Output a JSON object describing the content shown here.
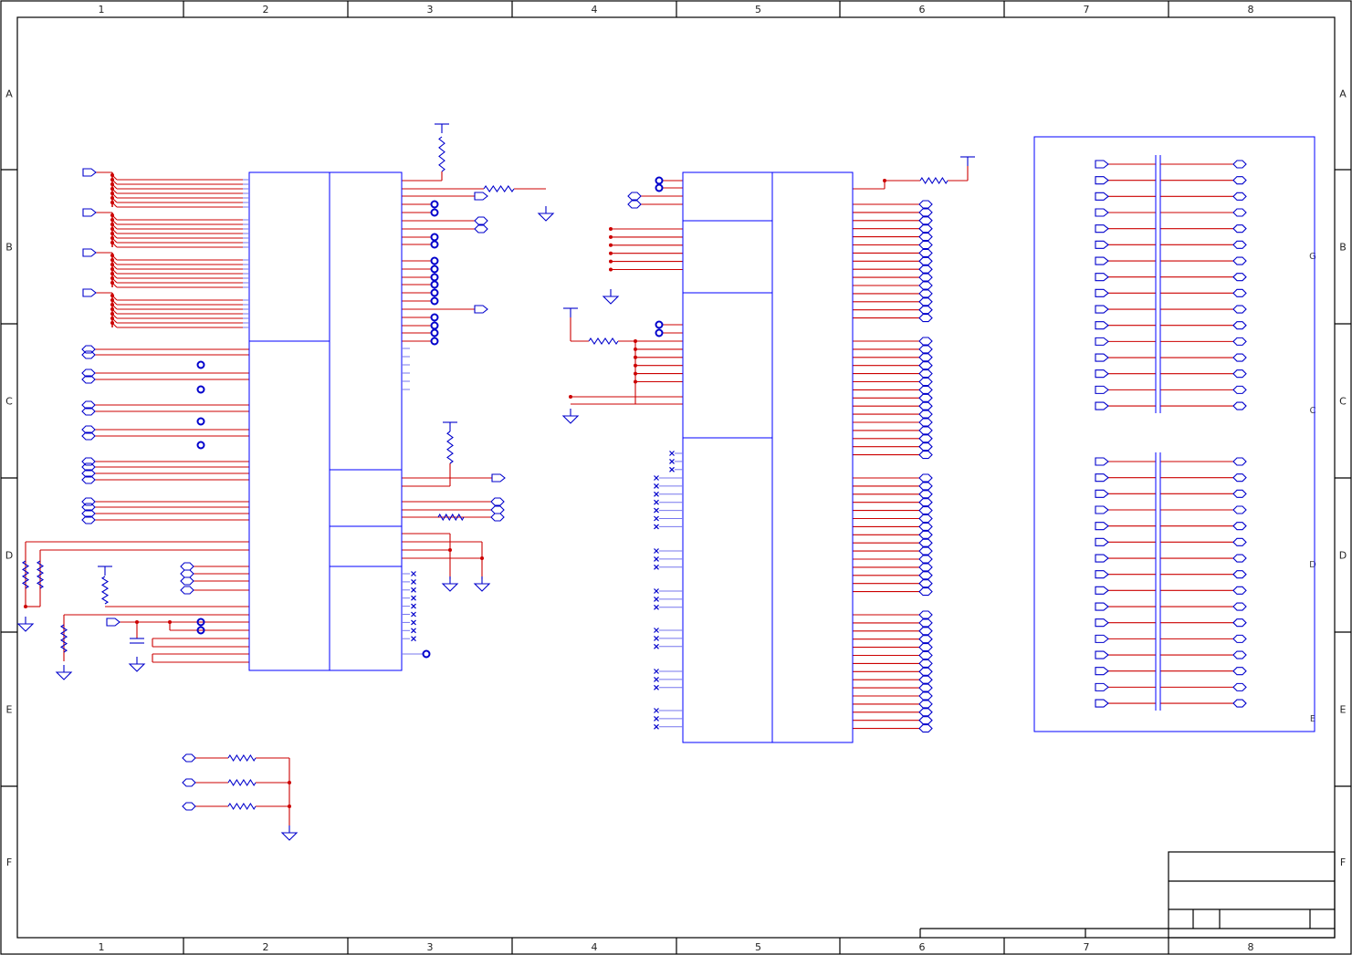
{
  "sheet": {
    "columns": [
      "1",
      "2",
      "3",
      "4",
      "5",
      "6",
      "7",
      "8"
    ],
    "rows": [
      "A",
      "B",
      "C",
      "D",
      "E",
      "F"
    ],
    "right_panel_rows": [
      "G",
      "C",
      "D",
      "E"
    ],
    "title_block": {
      "title": "",
      "document": "",
      "revision": "",
      "sheet": ""
    }
  },
  "colors": {
    "wire": "#cc0000",
    "symbol": "#0000cc",
    "chip_outline": "#0000ff",
    "frame": "#000000"
  },
  "icons": [
    "input-port-icon",
    "bidir-port-icon",
    "ground-icon",
    "power-icon",
    "resistor-icon",
    "capacitor-icon",
    "no-connect-icon",
    "off-page-connector-icon",
    "junction-dot-icon",
    "net-label-icon"
  ]
}
